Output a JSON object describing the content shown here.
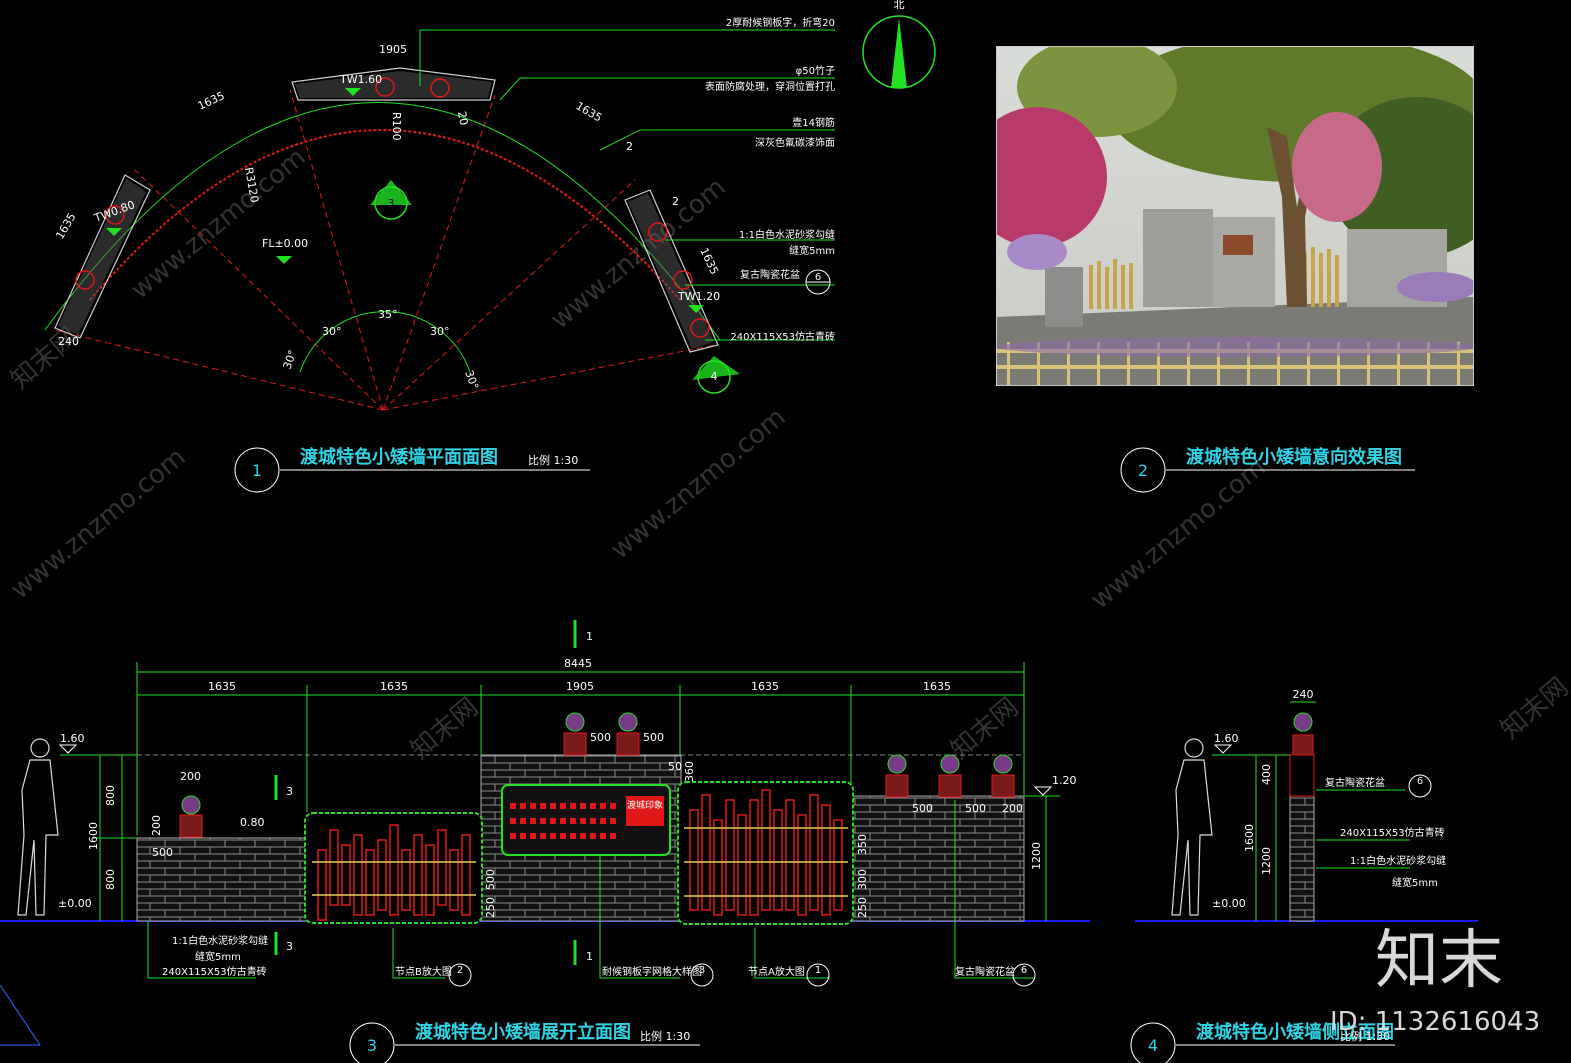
{
  "titles": {
    "t1": "渡城特色小矮墙平面面图",
    "t2": "渡城特色小矮墙意向效果图",
    "t3": "渡城特色小矮墙展开立面图",
    "t4": "渡城特色小矮墙侧立面图",
    "scale": "比例  1:30",
    "n1": "1",
    "n2": "2",
    "n3": "3",
    "n4": "4"
  },
  "plan": {
    "north": "北",
    "d1905": "1905",
    "d1635a": "1635",
    "d1635b": "1635",
    "d1635c": "1635",
    "d1635d": "1635",
    "d240": "240",
    "r3120": "R3120",
    "r100": "R100",
    "d20": "20",
    "d2a": "2",
    "d2b": "2",
    "tw160": "TW1.60",
    "tw080": "TW0.80",
    "tw120": "TW1.20",
    "fl": "FL±0.00",
    "a30a": "30°",
    "a30b": "30°",
    "a35": "35°",
    "a30c": "30°",
    "a30d": "30°",
    "sec3": "3",
    "sec4": "4",
    "note1": "2厚耐候钢板字，折弯20",
    "note2": "φ50竹子",
    "note3": "表面防腐处理，穿洞位置打孔",
    "note4": "壹14钢筋",
    "note5": "深灰色氟碳漆饰面",
    "note6": "1:1白色水泥砂浆勾缝",
    "note7": "缝宽5mm",
    "note8": "复古陶瓷花盆",
    "note9": "240X115X53仿古青砖",
    "ref6": "6"
  },
  "elev": {
    "total": "8445",
    "s1": "1635",
    "s2": "1635",
    "s3": "1905",
    "s4": "1635",
    "s5": "1635",
    "cut1": "1",
    "cut3": "3",
    "lv160": "1.60",
    "lv080": "0.80",
    "lv000": "±0.00",
    "lv120": "1.20",
    "h800a": "800",
    "h1600": "1600",
    "h800b": "800",
    "h200": "200",
    "h500": "500",
    "w200": "200",
    "w500": "500",
    "p500a": "500",
    "p500b": "500",
    "h50": "50",
    "h360": "360",
    "h350a": "350",
    "h350b": "350",
    "h300": "300",
    "h250a": "250",
    "h250b": "250",
    "h500b": "500",
    "w500c": "500",
    "w500d": "500",
    "w200b": "200",
    "h1200": "1200",
    "sign": "渡城印象",
    "n1": "1:1白色水泥砂浆勾缝",
    "n2": "缝宽5mm",
    "n3": "240X115X53仿古青砖",
    "n4": "节点B放大图",
    "n5": "耐候钢板字网格大样图",
    "n6": "节点A放大图",
    "n7": "复古陶瓷花盆",
    "r2": "2",
    "r3": "3",
    "r1": "1",
    "r6": "6"
  },
  "side": {
    "w240": "240",
    "lv160": "1.60",
    "lv000": "±0.00",
    "h400": "400",
    "h1600": "1600",
    "h1200": "1200",
    "n1": "复古陶瓷花盆",
    "n2": "240X115X53仿古青砖",
    "n3": "1:1白色水泥砂浆勾缝",
    "n4": "缝宽5mm",
    "r6": "6"
  },
  "watermark": {
    "site": "www.znzmo.com",
    "brand": "知末",
    "brand2": "知末网",
    "id": "ID: 1132616043"
  },
  "colors": {
    "green": "#22e022",
    "red": "#e01818",
    "cyan": "#2fd3e6",
    "grey": "#8a8a8a",
    "blue": "#1a1aff"
  }
}
